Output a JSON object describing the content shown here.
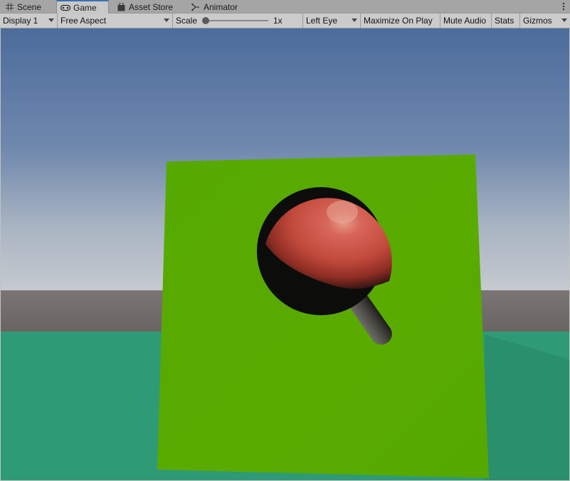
{
  "tabs": [
    {
      "label": "Scene",
      "icon": "grid-icon"
    },
    {
      "label": "Game",
      "icon": "gamepad-icon"
    },
    {
      "label": "Asset Store",
      "icon": "shopping-bag-icon"
    },
    {
      "label": "Animator",
      "icon": "animator-icon"
    }
  ],
  "active_tab": "Game",
  "toolbar": {
    "display": "Display 1",
    "aspect": "Free Aspect",
    "scale_label": "Scale",
    "scale_value": "1x",
    "eye": "Left Eye",
    "maximize": "Maximize On Play",
    "mute": "Mute Audio",
    "stats": "Stats",
    "gizmos": "Gizmos"
  },
  "scene": {
    "sky_top": "#4f6e9e",
    "sky_horizon": "#c4cad0",
    "ground_color": "#6d6866",
    "floor_color": "#2f9a76",
    "board_color": "#58ab00",
    "sphere_color": "#c84a3c",
    "handle_color": "#3a3a36"
  }
}
